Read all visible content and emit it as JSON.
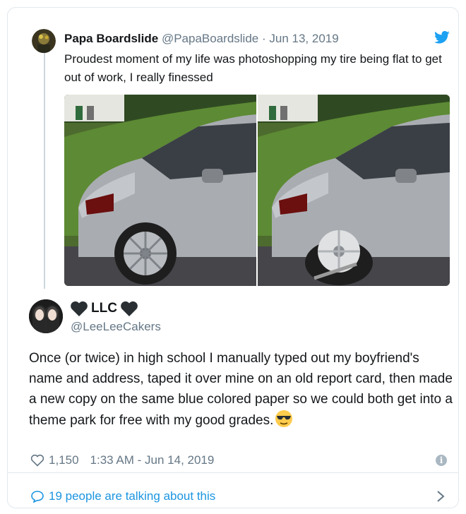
{
  "quoted_tweet": {
    "display_name": "Papa Boardslide",
    "handle": "@PapaBoardslide",
    "separator": "·",
    "date": "Jun 13, 2019",
    "text": "Proudest moment of my life was photoshopping my tire being flat to get out of work, I really finessed",
    "icons": {
      "platform": "twitter-bird-icon",
      "avatar": "avatar"
    },
    "colors": {
      "bird": "#1da1f2"
    }
  },
  "main_tweet": {
    "name_prefix_icon": "black-heart-icon",
    "display_name": "LLC",
    "name_suffix_icon": "black-heart-icon",
    "handle": "@LeeLeeCakers",
    "text": "Once (or twice) in high school I manually typed out my boyfriend's name and address, taped it over mine on an old report card, then made a new  copy on the same blue colored paper so we could both get into a theme park for free with my good grades.",
    "emoji": "sunglasses-emoji",
    "likes": "1,150",
    "timestamp": "1:33 AM - Jun 14, 2019"
  },
  "footer": {
    "talking_text": "19 people are talking about this",
    "link_color": "#1b95e0"
  }
}
